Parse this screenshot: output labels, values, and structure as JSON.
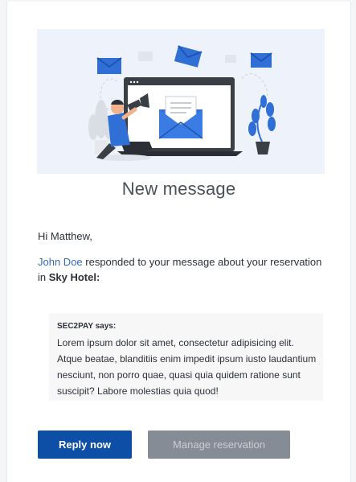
{
  "hero": {
    "illustration": "person-with-megaphone-and-laptop-email-illustration",
    "colors": {
      "background": "#eef2fb",
      "accent_blue": "#2f6fd6",
      "laptop": "#3a3f46"
    }
  },
  "header": {
    "title": "New message"
  },
  "body": {
    "greeting": "Hi Matthew,",
    "sender_name": "John Doe",
    "message_intro": " responded to your message about your reservation in ",
    "hotel_name": "Sky Hotel:",
    "quote": {
      "author": "SEC2PAY says:",
      "text": "Lorem ipsum dolor sit amet, consectetur adipisicing elit. Atque beatae, blanditiis enim impedit ipsum iusto laudantium nesciunt, non porro quae, quasi quia quidem ratione sunt suscipit? Labore molestias quia quod!"
    }
  },
  "actions": {
    "reply_label": "Reply now",
    "manage_label": "Manage reservation",
    "colors": {
      "primary": "#0d4ea6",
      "secondary": "#858c96"
    }
  }
}
